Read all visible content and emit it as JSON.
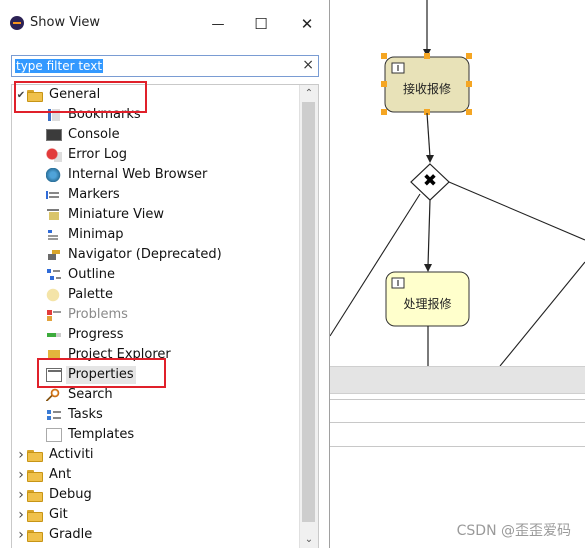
{
  "dialog": {
    "title": "Show View",
    "filter": {
      "value": "type filter text"
    },
    "clear_icon": "×",
    "window_buttons": {
      "minimize": "—",
      "maximize": "☐",
      "close": "✕"
    }
  },
  "tree": {
    "general": {
      "label": "General",
      "expanded": true
    },
    "general_items": [
      {
        "label": "Bookmarks",
        "icon": "bookmarks-icon"
      },
      {
        "label": "Console",
        "icon": "console-icon"
      },
      {
        "label": "Error Log",
        "icon": "error-log-icon"
      },
      {
        "label": "Internal Web Browser",
        "icon": "globe-icon"
      },
      {
        "label": "Markers",
        "icon": "markers-icon"
      },
      {
        "label": "Miniature View",
        "icon": "miniature-view-icon"
      },
      {
        "label": "Minimap",
        "icon": "minimap-icon"
      },
      {
        "label": "Navigator (Deprecated)",
        "icon": "navigator-icon"
      },
      {
        "label": "Outline",
        "icon": "outline-icon"
      },
      {
        "label": "Palette",
        "icon": "palette-icon"
      },
      {
        "label": "Problems",
        "icon": "problems-icon"
      },
      {
        "label": "Progress",
        "icon": "progress-icon"
      },
      {
        "label": "Project Explorer",
        "icon": "project-explorer-icon"
      },
      {
        "label": "Properties",
        "icon": "properties-icon"
      },
      {
        "label": "Search",
        "icon": "search-icon"
      },
      {
        "label": "Tasks",
        "icon": "tasks-icon"
      },
      {
        "label": "Templates",
        "icon": "templates-icon"
      }
    ],
    "categories": [
      {
        "label": "Activiti"
      },
      {
        "label": "Ant"
      },
      {
        "label": "Debug"
      },
      {
        "label": "Git"
      },
      {
        "label": "Gradle"
      }
    ]
  },
  "diagram": {
    "task1": "接收报修",
    "task2": "处理报修",
    "gateway": "✖"
  },
  "watermark": "CSDN @歪歪爱码",
  "colors": {
    "highlight": "#e0202a",
    "selection": "#3399ff",
    "folder": "#f0c14b",
    "task_fill": "#ffffcc"
  }
}
